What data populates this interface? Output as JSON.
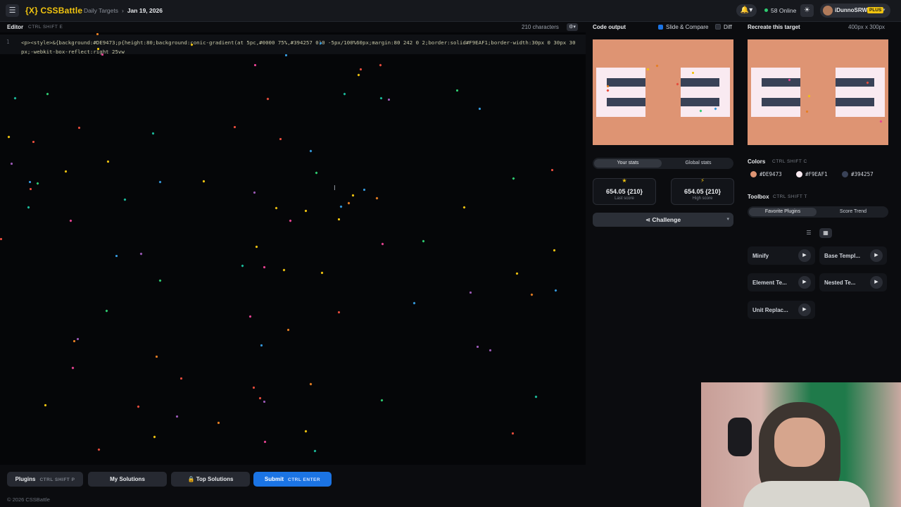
{
  "topbar": {
    "logo": "{X} CSSBattle",
    "breadcrumb_parent": "Daily Targets",
    "breadcrumb_current": "Jan 19, 2026",
    "online_count": "58 Online",
    "username": "iDunnoSRW",
    "plan_badge": "PLUS"
  },
  "editor": {
    "title": "Editor",
    "shortcut": "CTRL SHIFT E",
    "char_count": "210 characters",
    "line_number": "1",
    "code": "<p><style>&{background:#DE9473;p{height:80;background:conic-gradient(at 5pc,#0000 75%,#394257 0)0 -5px/100%60px;margin:80 242 0 2;border:solid#F9EAF1;border-width:30px 0 30px 30px;-webkit-box-reflect:right 25vw"
  },
  "bottom": {
    "plugins_label": "Plugins",
    "plugins_shortcut": "CTRL SHIFT P",
    "my_solutions": "My Solutions",
    "top_solutions": "Top Solutions",
    "submit_label": "Submit",
    "submit_shortcut": "CTRL ENTER",
    "copyright": "© 2026 CSSBattle"
  },
  "output": {
    "title": "Code output",
    "slide_compare": "Slide & Compare",
    "diff": "Diff",
    "target_title": "Recreate this target",
    "dimensions": "400px x 300px"
  },
  "stats": {
    "tab_your": "Your stats",
    "tab_global": "Global stats",
    "last_value": "654.05 {210}",
    "last_label": "Last score",
    "high_value": "654.05 {210}",
    "high_label": "High score",
    "challenge": "Challenge"
  },
  "colors": {
    "title": "Colors",
    "shortcut": "CTRL SHIFT C",
    "items": [
      {
        "hex": "#DE9473",
        "swatch": "#de9473"
      },
      {
        "hex": "#F9EAF1",
        "swatch": "#f9eaf1"
      },
      {
        "hex": "#394257",
        "swatch": "#394257"
      }
    ]
  },
  "toolbox": {
    "title": "Toolbox",
    "shortcut": "CTRL SHIFT T",
    "tab_favorite": "Favorite Plugins",
    "tab_trend": "Score Trend",
    "plugins": [
      "Minify",
      "Base Templ...",
      "Element Te...",
      "Nested Te...",
      "Unit Replac..."
    ]
  },
  "icons": {
    "menu": "menu-icon",
    "bell": "bell-icon",
    "theme": "sun-icon",
    "gear": "gear-icon",
    "lock": "lock-icon",
    "share": "share-icon",
    "play": "play-icon"
  }
}
